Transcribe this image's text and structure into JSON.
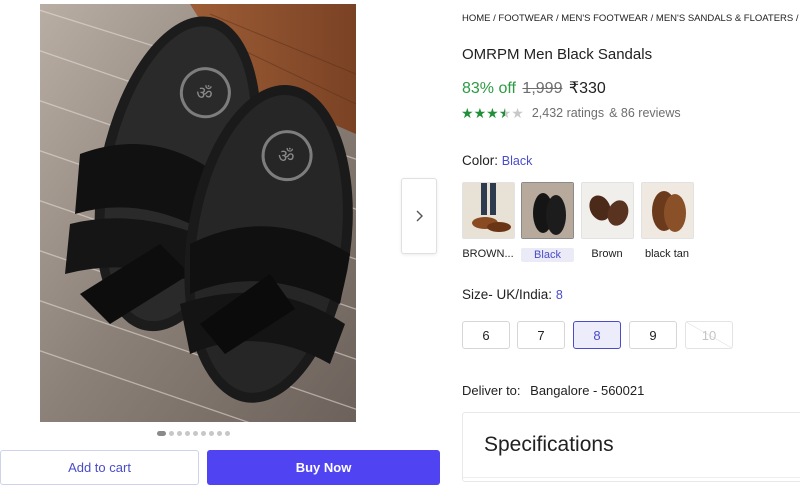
{
  "breadcrumb": "HOME / FOOTWEAR / MEN'S FOOTWEAR / MEN'S SANDALS & FLOATERS / OMRPM",
  "product": {
    "title": "OMRPM Men Black Sandals",
    "discount": "83% off",
    "mrp": "1,999",
    "price": "₹330",
    "rating_stars": 3.5,
    "ratings_text": "2,432 ratings",
    "reviews_text": "& 86 reviews"
  },
  "color": {
    "label": "Color:",
    "selected": "Black",
    "options": [
      {
        "label": "BROWN..."
      },
      {
        "label": "Black"
      },
      {
        "label": "Brown"
      },
      {
        "label": "black tan"
      }
    ]
  },
  "size": {
    "label": "Size- UK/India:",
    "selected": "8",
    "options": [
      {
        "label": "6"
      },
      {
        "label": "7"
      },
      {
        "label": "8"
      },
      {
        "label": "9"
      },
      {
        "label": "10"
      }
    ]
  },
  "delivery": {
    "label": "Deliver to:",
    "location": "Bangalore - 560021"
  },
  "specifications": {
    "title": "Specifications"
  },
  "buttons": {
    "add_to_cart": "Add to cart",
    "buy_now": "Buy Now"
  },
  "gallery": {
    "dot_count": 9,
    "active_index": 0
  },
  "colors": {
    "accent": "#4f43f2",
    "discount_green": "#2b9b43",
    "star_green": "#1f8f3a",
    "link_blue": "#4a4cc8"
  }
}
